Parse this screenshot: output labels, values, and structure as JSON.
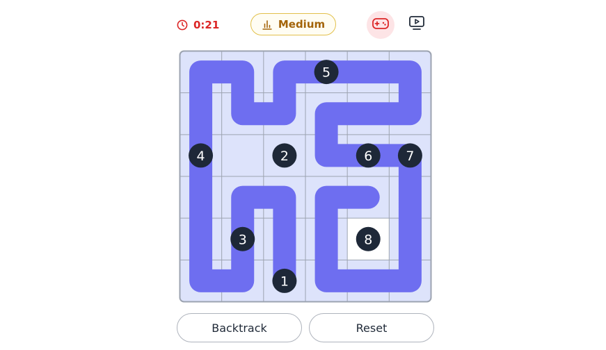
{
  "header": {
    "timer": "0:21",
    "timer_icon": "clock-icon",
    "difficulty": "Medium",
    "difficulty_icon": "bar-chart-icon",
    "game_icon": "gamepad-icon",
    "video_icon": "tv-play-icon"
  },
  "board": {
    "rows": 6,
    "cols": 6,
    "path_color": "#6e6ef0",
    "cell_bg": "#dde3fb",
    "grid_color": "#9ca3b0",
    "marker_color": "#1e2838",
    "empty_cells": [
      [
        4,
        4
      ]
    ],
    "path": [
      [
        5,
        2
      ],
      [
        4,
        2
      ],
      [
        3,
        2
      ],
      [
        3,
        1
      ],
      [
        4,
        1
      ],
      [
        5,
        1
      ],
      [
        5,
        0
      ],
      [
        4,
        0
      ],
      [
        3,
        0
      ],
      [
        2,
        0
      ],
      [
        1,
        0
      ],
      [
        0,
        0
      ],
      [
        0,
        1
      ],
      [
        1,
        1
      ],
      [
        1,
        2
      ],
      [
        0,
        2
      ],
      [
        0,
        3
      ],
      [
        0,
        4
      ],
      [
        0,
        5
      ],
      [
        1,
        5
      ],
      [
        1,
        4
      ],
      [
        1,
        3
      ],
      [
        2,
        3
      ],
      [
        2,
        4
      ],
      [
        2,
        5
      ],
      [
        3,
        5
      ],
      [
        4,
        5
      ],
      [
        5,
        5
      ],
      [
        5,
        4
      ],
      [
        5,
        3
      ],
      [
        4,
        3
      ],
      [
        3,
        3
      ],
      [
        3,
        4
      ]
    ],
    "numbers": [
      {
        "label": "1",
        "row": 5,
        "col": 2
      },
      {
        "label": "2",
        "row": 2,
        "col": 2
      },
      {
        "label": "3",
        "row": 4,
        "col": 1
      },
      {
        "label": "4",
        "row": 2,
        "col": 0
      },
      {
        "label": "5",
        "row": 0,
        "col": 3
      },
      {
        "label": "6",
        "row": 2,
        "col": 4
      },
      {
        "label": "7",
        "row": 2,
        "col": 5
      },
      {
        "label": "8",
        "row": 4,
        "col": 4
      }
    ]
  },
  "actions": {
    "backtrack": "Backtrack",
    "reset": "Reset"
  }
}
